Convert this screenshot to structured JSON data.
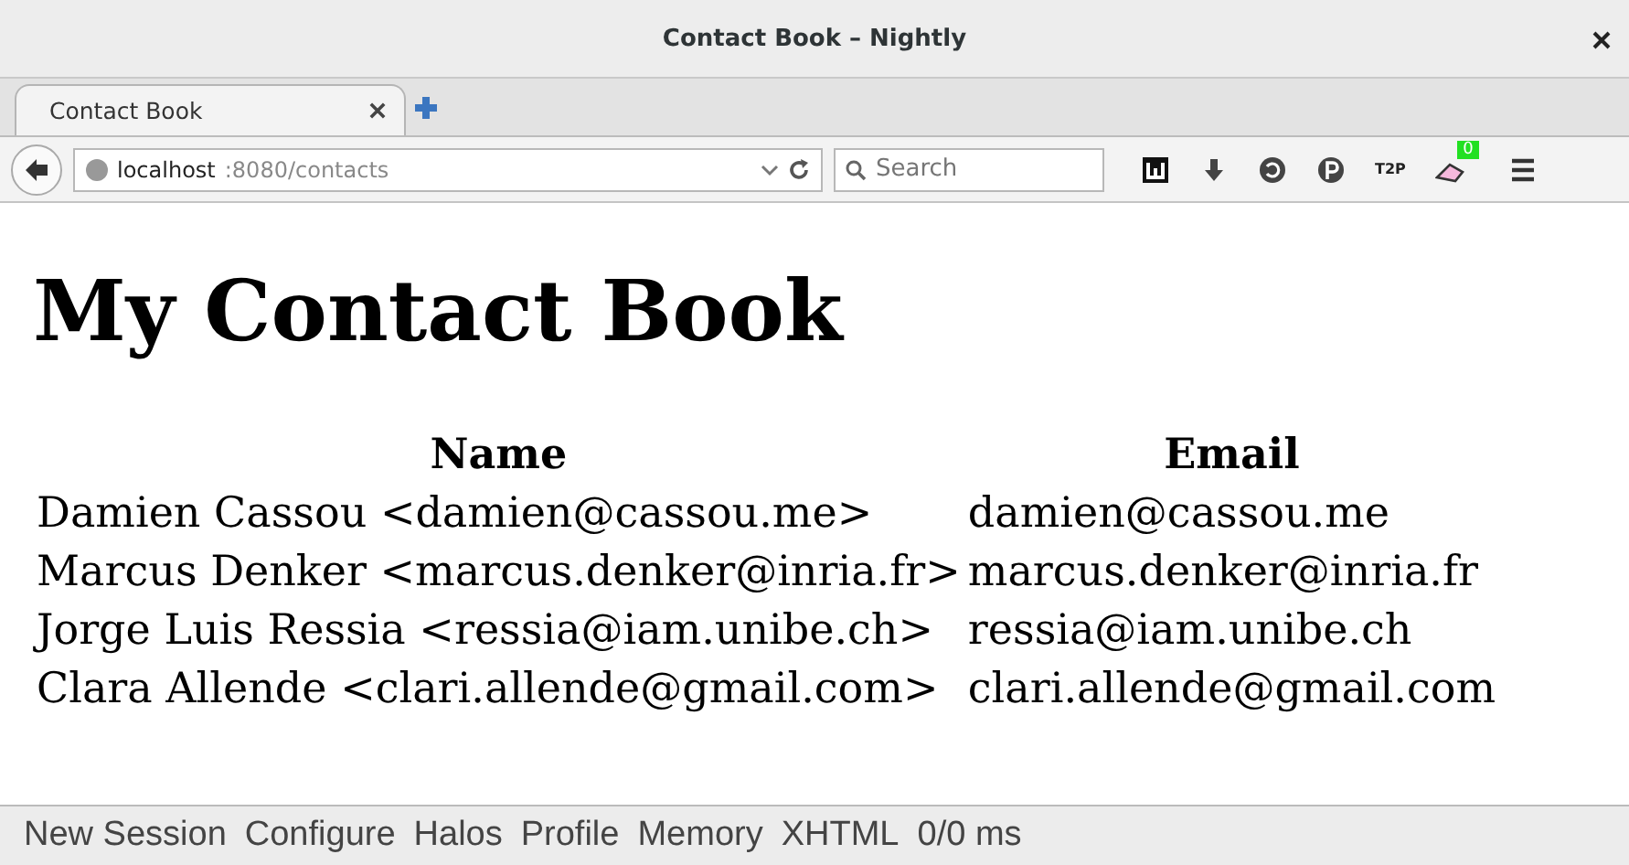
{
  "window": {
    "title": "Contact Book – Nightly"
  },
  "tabs": [
    {
      "label": "Contact Book",
      "selected": true
    }
  ],
  "address_bar": {
    "host": "localhost",
    "path": ":8080/contacts"
  },
  "search": {
    "placeholder": "Search"
  },
  "toolbar": {
    "text_icon": "T2P",
    "badge": "0"
  },
  "page": {
    "heading": "My Contact Book",
    "table": {
      "columns": [
        "Name",
        "Email"
      ],
      "rows": [
        [
          "Damien Cassou <damien@cassou.me>",
          "damien@cassou.me"
        ],
        [
          "Marcus Denker <marcus.denker@inria.fr>",
          "marcus.denker@inria.fr"
        ],
        [
          "Jorge Luis Ressia <ressia@iam.unibe.ch>",
          "ressia@iam.unibe.ch"
        ],
        [
          "Clara Allende <clari.allende@gmail.com>",
          "clari.allende@gmail.com"
        ]
      ]
    }
  },
  "status_bar": [
    "New Session",
    "Configure",
    "Halos",
    "Profile",
    "Memory",
    "XHTML",
    "0/0 ms"
  ]
}
